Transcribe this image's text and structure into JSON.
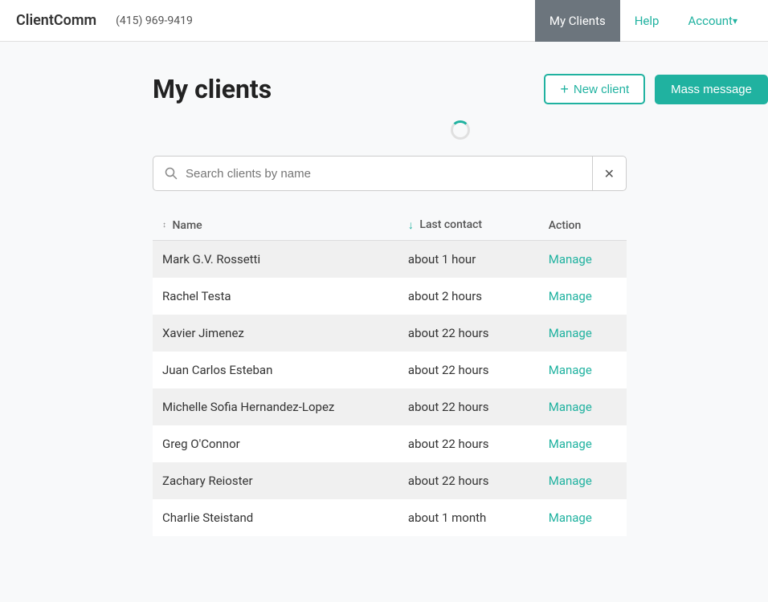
{
  "brand": {
    "name": "ClientComm",
    "phone": "(415) 969-9419"
  },
  "nav": {
    "my_clients": "My Clients",
    "help": "Help",
    "account": "Account"
  },
  "page": {
    "title": "My clients"
  },
  "buttons": {
    "new_client": "New client",
    "mass_message": "Mass message",
    "plus": "+"
  },
  "search": {
    "placeholder": "Search clients by name"
  },
  "table": {
    "columns": {
      "name": "Name",
      "last_contact": "Last contact",
      "action": "Action"
    },
    "manage_label": "Manage",
    "rows": [
      {
        "name": "Mark G.V. Rossetti",
        "last_contact": "about 1 hour"
      },
      {
        "name": "Rachel Testa",
        "last_contact": "about 2 hours"
      },
      {
        "name": "Xavier Jimenez",
        "last_contact": "about 22 hours"
      },
      {
        "name": "Juan Carlos Esteban",
        "last_contact": "about 22 hours"
      },
      {
        "name": "Michelle Sofia Hernandez-Lopez",
        "last_contact": "about 22 hours"
      },
      {
        "name": "Greg O'Connor",
        "last_contact": "about 22 hours"
      },
      {
        "name": "Zachary Reioster",
        "last_contact": "about 22 hours"
      },
      {
        "name": "Charlie Steistand",
        "last_contact": "about 1 month"
      }
    ]
  }
}
